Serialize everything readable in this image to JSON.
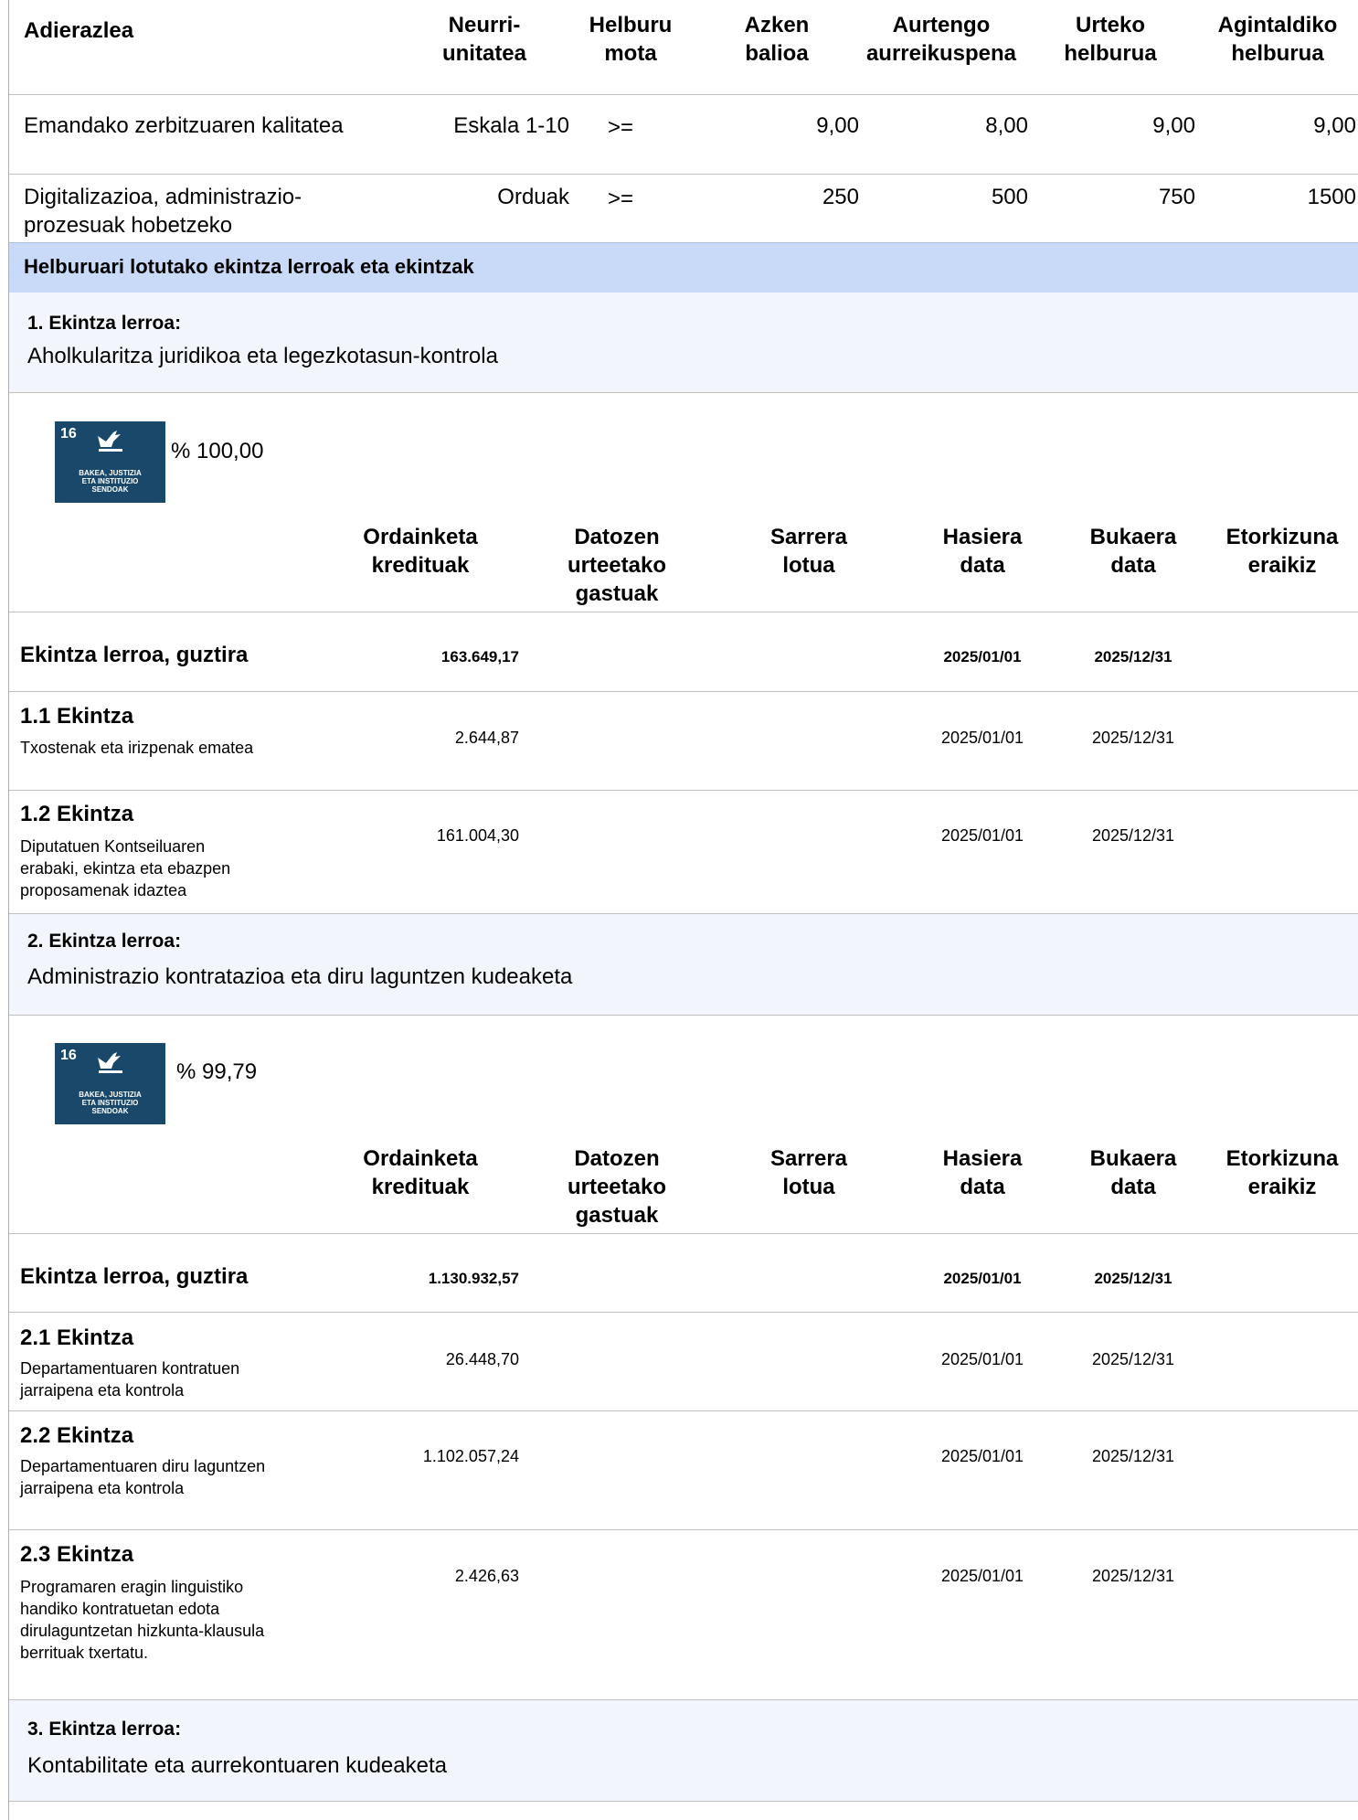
{
  "indicators": {
    "headers": {
      "indicator": "Adierazlea",
      "unit": "Neurri-\nunitatea",
      "goal_type": "Helburu\nmota",
      "last_value": "Azken\nbalioa",
      "current_forecast": "Aurtengo\naurreikuspena",
      "annual_goal": "Urteko\nhelburua",
      "term_goal": "Agintaldiko\nhelburua"
    },
    "rows": [
      {
        "indicator": "Emandako zerbitzuaren kalitatea",
        "unit": "Eskala 1-10",
        "goal_type": ">=",
        "last_value": "9,00",
        "current_forecast": "8,00",
        "annual_goal": "9,00",
        "term_goal": "9,00"
      },
      {
        "indicator": "Digitalizazioa, administrazio-\nprozesuak hobetzeko",
        "unit": "Orduak",
        "goal_type": ">=",
        "last_value": "250",
        "current_forecast": "500",
        "annual_goal": "750",
        "term_goal": "1500"
      }
    ]
  },
  "section_title": "Helburuari lotutako ekintza lerroak eta ekintzak",
  "action_table_headers": {
    "payment_credits": "Ordainketa\nkredituak",
    "future_expenses": "Datozen\nurteetako\ngastuak",
    "linked_income": "Sarrera\nlotua",
    "start_date": "Hasiera\ndata",
    "end_date": "Bukaera\ndata",
    "future_building": "Etorkizuna\neraikiz"
  },
  "sdg_badge": {
    "number": "16",
    "caption": "BAKEA, JUSTIZIA\nETA INSTITUZIO\nSENDOAK",
    "color": "#19486a",
    "icon": "dove-gavel-icon"
  },
  "total_label": "Ekintza lerroa, guztira",
  "lines": [
    {
      "title": "1. Ekintza lerroa:",
      "description": "Aholkularitza juridikoa eta legezkotasun-kontrola",
      "percentage": "% 100,00",
      "total": {
        "credits": "163.649,17",
        "start": "2025/01/01",
        "end": "2025/12/31"
      },
      "actions": [
        {
          "title": "1.1 Ekintza",
          "description": "Txostenak eta irizpenak ematea",
          "credits": "2.644,87",
          "start": "2025/01/01",
          "end": "2025/12/31"
        },
        {
          "title": "1.2 Ekintza",
          "description": "Diputatuen Kontseiluaren\nerabaki, ekintza eta ebazpen\nproposamenak idaztea",
          "credits": "161.004,30",
          "start": "2025/01/01",
          "end": "2025/12/31"
        }
      ]
    },
    {
      "title": "2. Ekintza lerroa:",
      "description": "Administrazio kontratazioa eta diru laguntzen kudeaketa",
      "percentage": "% 99,79",
      "total": {
        "credits": "1.130.932,57",
        "start": "2025/01/01",
        "end": "2025/12/31"
      },
      "actions": [
        {
          "title": "2.1 Ekintza",
          "description": "Departamentuaren kontratuen\njarraipena eta kontrola",
          "credits": "26.448,70",
          "start": "2025/01/01",
          "end": "2025/12/31"
        },
        {
          "title": "2.2 Ekintza",
          "description": "Departamentuaren diru laguntzen\njarraipena eta kontrola",
          "credits": "1.102.057,24",
          "start": "2025/01/01",
          "end": "2025/12/31"
        },
        {
          "title": "2.3 Ekintza",
          "description": "Programaren eragin linguistiko\nhandiko kontratuetan edota\ndirulaguntzetan hizkunta-klausula\nberrituak txertatu.",
          "credits": "2.426,63",
          "start": "2025/01/01",
          "end": "2025/12/31"
        }
      ]
    },
    {
      "title": "3. Ekintza lerroa:",
      "description": "Kontabilitate eta aurrekontuaren kudeaketa"
    }
  ],
  "colors": {
    "section_header_bg": "#c9daf8",
    "line_header_bg": "#f2f6fc",
    "rule": "#c0c0c0"
  }
}
